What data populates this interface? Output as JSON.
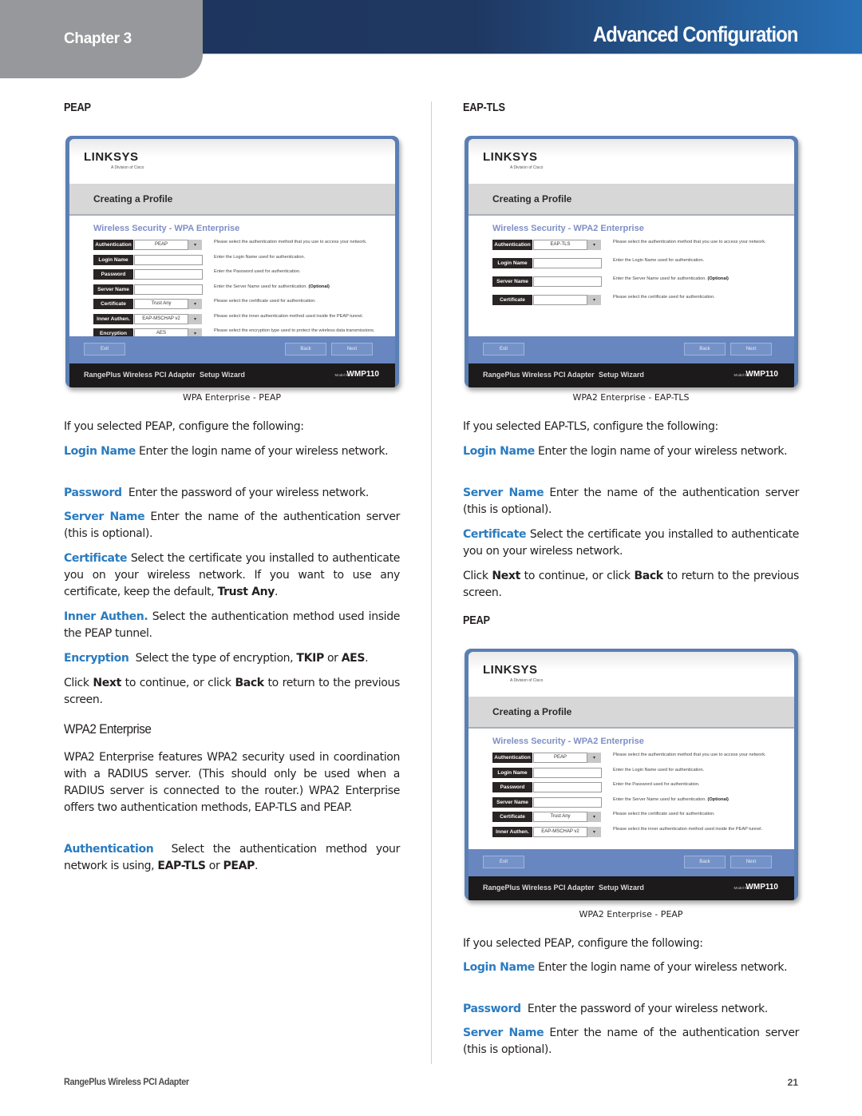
{
  "header": {
    "chapter": "Chapter 3",
    "title": "Advanced Configuration",
    "colors": {
      "bar_dark": "#1e355c",
      "bar_light": "#2870b6",
      "tab": "#97989b",
      "keyword": "#2a7bc0"
    }
  },
  "left": {
    "subhead": "PEAP",
    "figure": {
      "logo": "LINKSYS",
      "logo_sub": "A Division of Cisco",
      "band_title": "Creating a Profile",
      "section_title": "Wireless Security - WPA Enterprise",
      "rows": [
        {
          "label": "Authentication",
          "value": "PEAP",
          "dropdown": true,
          "help": "Please select the authentication method that you use to access your network."
        },
        {
          "label": "Login Name",
          "value": "",
          "dropdown": false,
          "help": "Enter the Login Name used for authentication."
        },
        {
          "label": "Password",
          "value": "",
          "dropdown": false,
          "help": "Enter the Password used for authentication."
        },
        {
          "label": "Server Name",
          "value": "",
          "dropdown": false,
          "help": "Enter the Server Name used for authentication.",
          "help_bold": "(Optional)"
        },
        {
          "label": "Certificate",
          "value": "Trust Any",
          "dropdown": true,
          "help": "Please select the certificate used for authentication."
        },
        {
          "label": "Inner Authen.",
          "value": "EAP-MSCHAP v2",
          "dropdown": true,
          "help": "Please select the inner authentication method used inside the PEAP tunnel."
        },
        {
          "label": "Encryption",
          "value": "AES",
          "dropdown": true,
          "help": "Please select the encryption type used to protect the wireless data transmissions."
        }
      ],
      "buttons": {
        "exit": "Exit",
        "back": "Back",
        "next": "Next"
      },
      "footer": {
        "product": "RangePlus Wireless PCI Adapter",
        "wizard": "Setup Wizard",
        "model_label": "Model No.",
        "model": "WMP110"
      },
      "caption": "WPA Enterprise - PEAP"
    },
    "intro": "If you selected PEAP, configure the following:",
    "items": [
      {
        "term": "Login Name",
        "text": " Enter the login name of your wireless network."
      },
      {
        "term": "Password",
        "text": "  Enter the password of your wireless network."
      },
      {
        "term": "Server Name",
        "text": "  Enter the name of the authentication server (this is optional)."
      },
      {
        "term": "Certificate",
        "text": " Select the certificate you installed to authenticate you on your wireless network. If you want to use any certificate, keep the default, ",
        "bold": "Trust Any",
        "tail": "."
      },
      {
        "term": "Inner Authen.",
        "text": " Select the authentication method used inside the PEAP tunnel."
      }
    ],
    "encryption": {
      "term": "Encryption",
      "text": "  Select the type of encryption, ",
      "b1": "TKIP",
      "mid": " or ",
      "b2": "AES",
      "tail": "."
    },
    "click": {
      "pre": "Click ",
      "next": "Next",
      "mid": " to continue, or click ",
      "back": "Back",
      "tail": " to return to the previous screen."
    },
    "wpa2_heading": "WPA2 Enterprise",
    "wpa2_text": "WPA2 Enterprise features WPA2 security used in coordination with a RADIUS server. (This should only be used when a RADIUS server is connected to the router.) WPA2 Enterprise offers two authentication methods, EAP-TLS and PEAP.",
    "auth": {
      "term": "Authentication",
      "text": "  Select the authentication method your network is using, ",
      "b1": "EAP-TLS",
      "mid": " or ",
      "b2": "PEAP",
      "tail": "."
    }
  },
  "right": {
    "subhead": "EAP-TLS",
    "figure": {
      "logo": "LINKSYS",
      "logo_sub": "A Division of Cisco",
      "band_title": "Creating a Profile",
      "section_title": "Wireless Security - WPA2 Enterprise",
      "rows": [
        {
          "label": "Authentication",
          "value": "EAP-TLS",
          "dropdown": true,
          "help": "Please select the authentication method that you use to access your network."
        },
        {
          "label": "Login Name",
          "value": "",
          "dropdown": false,
          "help": "Enter the Login Name used for authentication."
        },
        {
          "label": "Server Name",
          "value": "",
          "dropdown": false,
          "help": "Enter the Server Name used for authentication.",
          "help_bold": "(Optional)"
        },
        {
          "label": "Certificate",
          "value": "",
          "dropdown": true,
          "help": "Please select the certificate used for authentication."
        }
      ],
      "buttons": {
        "exit": "Exit",
        "back": "Back",
        "next": "Next"
      },
      "footer": {
        "product": "RangePlus Wireless PCI Adapter",
        "wizard": "Setup Wizard",
        "model_label": "Model No.",
        "model": "WMP110"
      },
      "caption": "WPA2 Enterprise - EAP-TLS"
    },
    "intro": "If you selected EAP-TLS, configure the following:",
    "items": [
      {
        "term": "Login Name",
        "text": " Enter the login name of your wireless network."
      },
      {
        "term": "Server Name",
        "text": "  Enter the name of the authentication server (this is optional)."
      },
      {
        "term": "Certificate",
        "text": " Select the certificate you installed to authenticate you on your wireless network."
      }
    ],
    "click": {
      "pre": "Click ",
      "next": "Next",
      "mid": " to continue, or click ",
      "back": "Back",
      "tail": " to return to the previous screen."
    },
    "subhead2": "PEAP",
    "figure2": {
      "logo": "LINKSYS",
      "logo_sub": "A Division of Cisco",
      "band_title": "Creating a Profile",
      "section_title": "Wireless Security - WPA2 Enterprise",
      "rows": [
        {
          "label": "Authentication",
          "value": "PEAP",
          "dropdown": true,
          "help": "Please select the authentication method that you use to access your network."
        },
        {
          "label": "Login Name",
          "value": "",
          "dropdown": false,
          "help": "Enter the Login Name used for authentication."
        },
        {
          "label": "Password",
          "value": "",
          "dropdown": false,
          "help": "Enter the Password used for authentication."
        },
        {
          "label": "Server Name",
          "value": "",
          "dropdown": false,
          "help": "Enter the Server Name used for authentication.",
          "help_bold": "(Optional)"
        },
        {
          "label": "Certificate",
          "value": "Trust Any",
          "dropdown": true,
          "help": "Please select the certificate used for authentication."
        },
        {
          "label": "Inner Authen.",
          "value": "EAP-MSCHAP v2",
          "dropdown": true,
          "help": "Please select the inner authentication method used inside the PEAP tunnel."
        }
      ],
      "buttons": {
        "exit": "Exit",
        "back": "Back",
        "next": "Next"
      },
      "footer": {
        "product": "RangePlus Wireless PCI Adapter",
        "wizard": "Setup Wizard",
        "model_label": "Model No.",
        "model": "WMP110"
      },
      "caption": "WPA2 Enterprise - PEAP"
    },
    "intro2": "If you selected PEAP, configure the following:",
    "items2": [
      {
        "term": "Login Name",
        "text": " Enter the login name of your wireless network."
      },
      {
        "term": "Password",
        "text": "  Enter the password of your wireless network."
      },
      {
        "term": "Server Name",
        "text": "  Enter the name of the authentication server (this is optional)."
      }
    ]
  },
  "footer": {
    "product": "RangePlus Wireless PCI Adapter",
    "page": "21"
  }
}
